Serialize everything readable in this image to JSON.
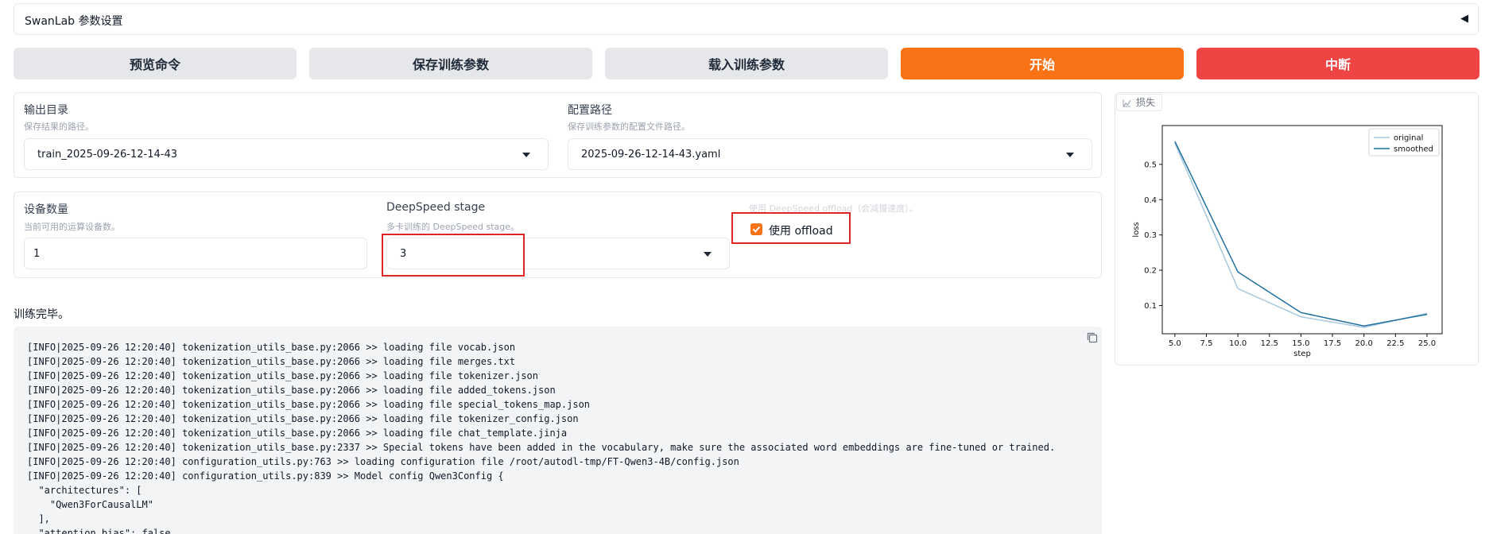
{
  "accordion": {
    "title": "SwanLab 参数设置",
    "arrow": "◀"
  },
  "buttons": {
    "preview": "预览命令",
    "save": "保存训练参数",
    "load": "载入训练参数",
    "start": "开始",
    "abort": "中断"
  },
  "colors": {
    "orange": "#f97316",
    "red": "#ef4444",
    "highlight_box": "#dc2626"
  },
  "output": {
    "label": "输出目录",
    "info": "保存结果的路径。",
    "value": "train_2025-09-26-12-14-43"
  },
  "config": {
    "label": "配置路径",
    "info": "保存训练参数的配置文件路径。",
    "value": "2025-09-26-12-14-43.yaml"
  },
  "devices": {
    "label": "设备数量",
    "info": "当前可用的运算设备数。",
    "value": "1"
  },
  "deepspeed": {
    "label": "DeepSpeed stage",
    "info": "多卡训练的 DeepSpeed stage。",
    "value": "3"
  },
  "offload": {
    "info": "使用 DeepSpeed offload（会减慢速度）。",
    "checkbox_label": "使用 offload",
    "checked": true
  },
  "status": "训练完毕。",
  "log_lines": [
    "[INFO|2025-09-26 12:20:40] tokenization_utils_base.py:2066 >> loading file vocab.json",
    "[INFO|2025-09-26 12:20:40] tokenization_utils_base.py:2066 >> loading file merges.txt",
    "[INFO|2025-09-26 12:20:40] tokenization_utils_base.py:2066 >> loading file tokenizer.json",
    "[INFO|2025-09-26 12:20:40] tokenization_utils_base.py:2066 >> loading file added_tokens.json",
    "[INFO|2025-09-26 12:20:40] tokenization_utils_base.py:2066 >> loading file special_tokens_map.json",
    "[INFO|2025-09-26 12:20:40] tokenization_utils_base.py:2066 >> loading file tokenizer_config.json",
    "[INFO|2025-09-26 12:20:40] tokenization_utils_base.py:2066 >> loading file chat_template.jinja",
    "[INFO|2025-09-26 12:20:40] tokenization_utils_base.py:2337 >> Special tokens have been added in the vocabulary, make sure the associated word embeddings are fine-tuned or trained.",
    "[INFO|2025-09-26 12:20:40] configuration_utils.py:763 >> loading configuration file /root/autodl-tmp/FT-Qwen3-4B/config.json",
    "[INFO|2025-09-26 12:20:40] configuration_utils.py:839 >> Model config Qwen3Config {",
    "  \"architectures\": [",
    "    \"Qwen3ForCausalLM\"",
    "  ],",
    "  \"attention_bias\": false,"
  ],
  "plot_tab": "损失",
  "chart_data": {
    "type": "line",
    "xlabel": "step",
    "ylabel": "loss",
    "xlim": [
      4.0,
      26.2
    ],
    "ylim": [
      0.02,
      0.61
    ],
    "xticks": [
      "5.0",
      "7.5",
      "10.0",
      "12.5",
      "15.0",
      "17.5",
      "20.0",
      "22.5",
      "25.0"
    ],
    "yticks": [
      "0.1",
      "0.2",
      "0.3",
      "0.4",
      "0.5"
    ],
    "legend_position": "top-right",
    "series": [
      {
        "name": "original",
        "color": "#a9c8dc",
        "x": [
          5,
          10,
          15,
          20,
          25
        ],
        "y": [
          0.56,
          0.148,
          0.068,
          0.038,
          0.078
        ]
      },
      {
        "name": "smoothed",
        "color": "#1f6fa0",
        "x": [
          5,
          10,
          15,
          20,
          25
        ],
        "y": [
          0.565,
          0.195,
          0.08,
          0.042,
          0.075
        ]
      }
    ]
  }
}
